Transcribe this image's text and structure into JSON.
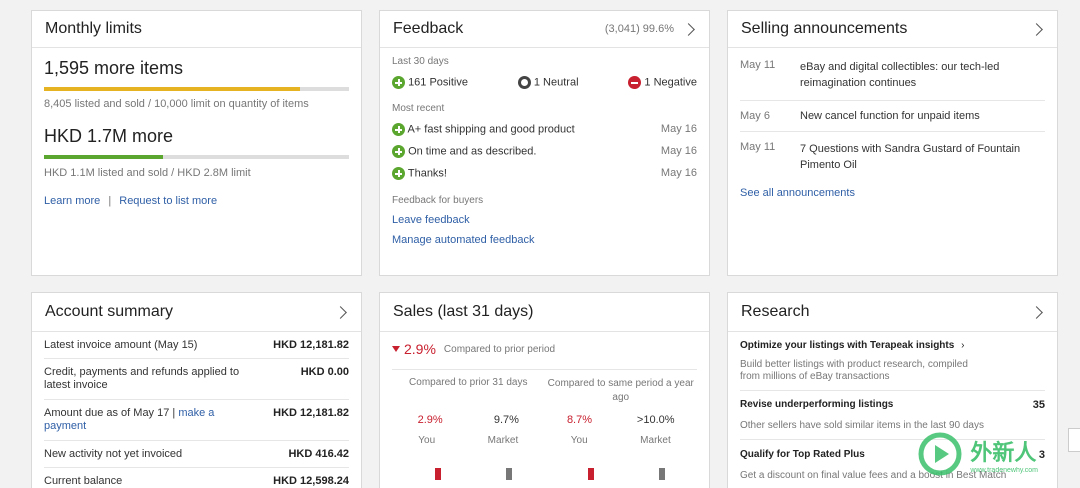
{
  "monthly_limits": {
    "title": "Monthly limits",
    "items_more": "1,595 more items",
    "items_detail": "8,405 listed and sold /  10,000 limit on quantity of items",
    "items_progress": 0.84,
    "amount_more": "HKD 1.7M more",
    "amount_detail": "HKD 1.1M listed and sold /  HKD 2.8M limit",
    "amount_progress": 0.39,
    "learn_more": "Learn more",
    "request_more": "Request to list more",
    "colors": {
      "items_bar": "#e6b422",
      "amount_bar": "#5aa62e"
    }
  },
  "feedback": {
    "title": "Feedback",
    "score": "(3,041) 99.6%",
    "last_30": "Last 30 days",
    "positive": "161 Positive",
    "neutral": "1 Neutral",
    "negative": "1 Negative",
    "most_recent": "Most recent",
    "recent": [
      {
        "text": "A+ fast shipping and good product",
        "date": "May 16"
      },
      {
        "text": "On time and as described.",
        "date": "May 16"
      },
      {
        "text": "Thanks!",
        "date": "May 16"
      }
    ],
    "for_buyers": "Feedback for buyers",
    "leave": "Leave feedback",
    "manage": "Manage automated feedback"
  },
  "announcements": {
    "title": "Selling announcements",
    "items": [
      {
        "date": "May 11",
        "text": "eBay and digital collectibles: our tech-led reimagination continues"
      },
      {
        "date": "May 6",
        "text": "New cancel function for unpaid items"
      },
      {
        "date": "May 11",
        "text": "7 Questions with Sandra Gustard of Fountain Pimento Oil"
      }
    ],
    "see_all": "See all announcements"
  },
  "account_summary": {
    "title": "Account summary",
    "rows": [
      {
        "label": "Latest invoice amount (May 15)",
        "value": "HKD 12,181.82"
      },
      {
        "label": "Credit, payments and refunds applied to latest invoice",
        "value": "HKD 0.00"
      },
      {
        "label_prefix": "Amount due as of May 17 | ",
        "label_link": "make a payment",
        "value": "HKD 12,181.82"
      },
      {
        "label": "New activity not yet invoiced",
        "value": "HKD 416.42"
      },
      {
        "label": "Current balance",
        "value": "HKD 12,598.24"
      }
    ]
  },
  "sales": {
    "title": "Sales (last 31 days)",
    "change": "2.9%",
    "change_caption": "Compared to prior period",
    "col1_caption": "Compared to prior 31 days",
    "col2_caption": "Compared to same period a year ago",
    "col1": [
      {
        "value": "2.9%",
        "label": "You"
      },
      {
        "value": "9.7%",
        "label": "Market"
      }
    ],
    "col2": [
      {
        "value": "8.7%",
        "label": "You"
      },
      {
        "value": ">10.0%",
        "label": "Market"
      }
    ]
  },
  "research": {
    "title": "Research",
    "item1_title": "Optimize your listings with Terapeak insights",
    "item1_desc": "Build better listings with product research, compiled from millions of eBay transactions",
    "item2_title": "Revise underperforming listings",
    "item2_count": "35",
    "item2_desc": "Other sellers have sold similar items in the last 90 days",
    "item3_title": "Qualify for Top Rated Plus",
    "item3_count": "3",
    "item3_desc": "Get a discount on final value fees and a boost in Best Match"
  },
  "watermark": {
    "cn": "外新人",
    "url": "www.tradenewhy.com"
  }
}
